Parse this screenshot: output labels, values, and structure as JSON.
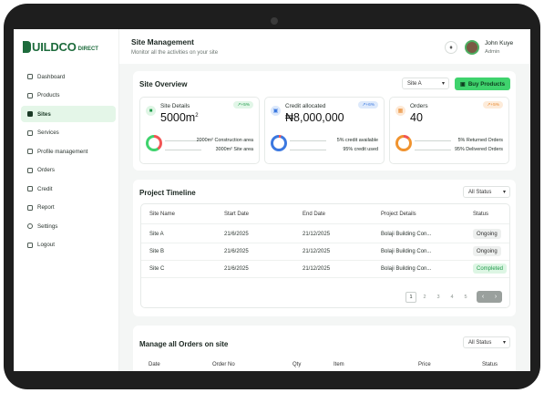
{
  "brand": {
    "logo_main": "UILDCO",
    "logo_sub": "DIRECT"
  },
  "sidebar": {
    "items": [
      {
        "label": "Dashboard",
        "active": false
      },
      {
        "label": "Products",
        "active": false
      },
      {
        "label": "Sites",
        "active": true
      },
      {
        "label": "Services",
        "active": false
      },
      {
        "label": "Profile management",
        "active": false
      },
      {
        "label": "Orders",
        "active": false
      },
      {
        "label": "Credit",
        "active": false
      },
      {
        "label": "Report",
        "active": false
      },
      {
        "label": "Settings",
        "active": false
      },
      {
        "label": "Logout",
        "active": false
      }
    ]
  },
  "header": {
    "title": "Site Management",
    "subtitle": "Monitor all the activities on your site",
    "user_name": "John Kuye",
    "user_role": "Admin"
  },
  "overview": {
    "title": "Site Overview",
    "site_select": "Site A",
    "buy_label": "Buy Products",
    "cards": [
      {
        "label": "Site Details",
        "value": "5000m",
        "sup": "2",
        "badge": "+5%",
        "line1": "2000m² Construction area",
        "line2": "3000m² Site area",
        "icon": "site-icon"
      },
      {
        "label": "Credit allocated",
        "value": "₦8,000,000",
        "sup": "",
        "badge": "+6%",
        "line1": "5% credit available",
        "line2": "95% credit used",
        "icon": "credit-icon"
      },
      {
        "label": "Orders",
        "value": "40",
        "sup": "",
        "badge": "+5%",
        "line1": "5% Returned Orders",
        "line2": "95% Delivered Orders",
        "icon": "orders-icon"
      }
    ]
  },
  "timeline": {
    "title": "Project Timeline",
    "filter": "All Status",
    "columns": [
      "Site Name",
      "Start Date",
      "End Date",
      "Project Details",
      "Status"
    ],
    "rows": [
      {
        "site": "Site A",
        "start": "21/6/2025",
        "end": "21/12/2025",
        "details": "Bolaji Building Con...",
        "status": "Ongoing"
      },
      {
        "site": "Site B",
        "start": "21/6/2025",
        "end": "21/12/2025",
        "details": "Bolaji Building Con...",
        "status": "Ongoing"
      },
      {
        "site": "Site C",
        "start": "21/6/2025",
        "end": "21/12/2025",
        "details": "Bolaji Building Con...",
        "status": "Completed"
      }
    ],
    "pages": [
      "1",
      "2",
      "3",
      "4",
      "5"
    ]
  },
  "orders": {
    "title": "Manage all Orders on site",
    "filter": "All Status",
    "columns": [
      "Date",
      "Order No",
      "Qty",
      "Item",
      "Price",
      "Status"
    ]
  },
  "colors": {
    "accent": "#3fd36d",
    "brand": "#1d6b3c",
    "ongoing_bg": "#eef0ef",
    "completed_bg": "#ddf6e4",
    "completed_fg": "#1f9a4a"
  }
}
